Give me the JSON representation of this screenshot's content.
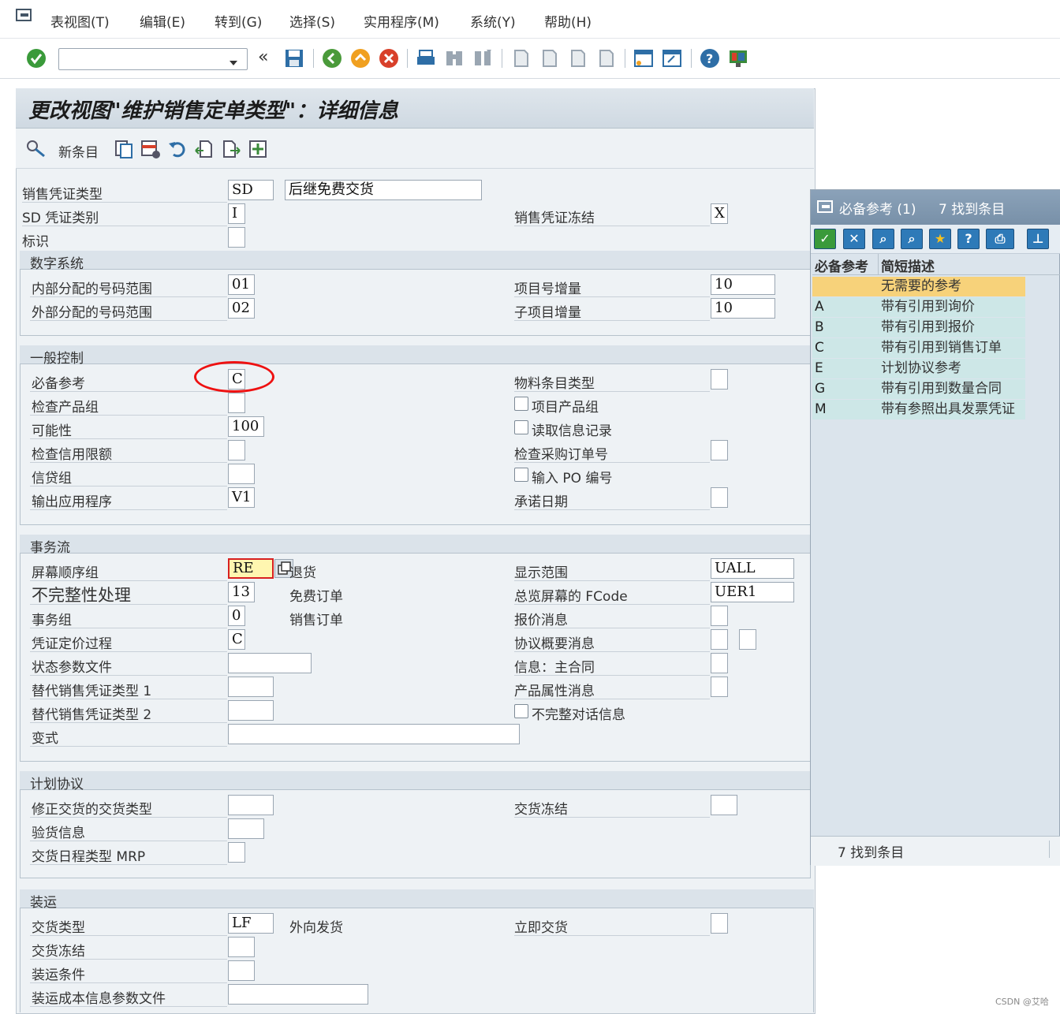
{
  "menu": [
    "表视图(T)",
    "编辑(E)",
    "转到(G)",
    "选择(S)",
    "实用程序(M)",
    "系统(Y)",
    "帮助(H)"
  ],
  "toolbar": {
    "command_field_value": "",
    "back_glyph": "«"
  },
  "title": "更改视图\"维护销售定单类型\"：详细信息",
  "app_toolbar": {
    "new_entries": "新条目"
  },
  "header": {
    "sales_doc_type_label": "销售凭证类型",
    "sales_doc_type_value": "SD",
    "sales_doc_type_desc": "后继免费交货",
    "sd_category_label": "SD 凭证类别",
    "sd_category_value": "I",
    "sales_doc_block_label": "销售凭证冻结",
    "sales_doc_block_value": "X",
    "indicator_label": "标识",
    "indicator_value": ""
  },
  "number_system": {
    "title": "数字系统",
    "internal_label": "内部分配的号码范围",
    "internal_value": "01",
    "external_label": "外部分配的号码范围",
    "external_value": "02",
    "item_inc_label": "项目号增量",
    "item_inc_value": "10",
    "subitem_inc_label": "子项目增量",
    "subitem_inc_value": "10"
  },
  "general_control": {
    "title": "一般控制",
    "ref_mandatory_label": "必备参考",
    "ref_mandatory_value": "C",
    "check_div_label": "检查产品组",
    "check_div_value": "",
    "probability_label": "可能性",
    "probability_value": "100",
    "check_credit_label": "检查信用限额",
    "check_credit_value": "",
    "credit_group_label": "信贷组",
    "credit_group_value": "",
    "output_app_label": "输出应用程序",
    "output_app_value": "V1",
    "item_cat_label": "物料条目类型",
    "item_cat_value": "",
    "item_div_label": "项目产品组",
    "read_info_label": "读取信息记录",
    "check_po_label": "检查采购订单号",
    "check_po_value": "",
    "enter_po_label": "输入 PO 编号",
    "commit_date_label": "承诺日期",
    "commit_date_value": ""
  },
  "transaction_flow": {
    "title": "事务流",
    "screen_seq_label": "屏幕顺序组",
    "screen_seq_value": "RE",
    "screen_seq_desc": "退货",
    "incomp_label": "不完整性处理",
    "incomp_value": "13",
    "incomp_desc": "免费订单",
    "trans_group_label": "事务组",
    "trans_group_value": "0",
    "trans_group_desc": "销售订单",
    "pricing_label": "凭证定价过程",
    "pricing_value": "C",
    "status_profile_label": "状态参数文件",
    "status_profile_value": "",
    "alt1_label": "替代销售凭证类型 1",
    "alt1_value": "",
    "alt2_label": "替代销售凭证类型 2",
    "alt2_value": "",
    "variant_label": "变式",
    "variant_value": "",
    "display_range_label": "显示范围",
    "display_range_value": "UALL",
    "fcode_label": "总览屏幕的 FCode",
    "fcode_value": "UER1",
    "quot_msg_label": "报价消息",
    "quot_msg_value": "",
    "agreement_msg_label": "协议概要消息",
    "agreement_msg_value": "",
    "agreement_msg_value2": "",
    "master_contract_label": "信息：主合同",
    "master_contract_value": "",
    "product_attr_label": "产品属性消息",
    "product_attr_value": "",
    "incomp_dialog_label": "不完整对话信息"
  },
  "scheduling_agreement": {
    "title": "计划协议",
    "corr_del_label": "修正交货的交货类型",
    "corr_del_value": "",
    "gr_info_label": "验货信息",
    "gr_info_value": "",
    "mrp_label": "交货日程类型 MRP",
    "mrp_value": "",
    "del_block_label": "交货冻结",
    "del_block_value": ""
  },
  "shipping": {
    "title": "装运",
    "del_type_label": "交货类型",
    "del_type_value": "LF",
    "del_type_desc": "外向发货",
    "ship_block_label": "交货冻结",
    "ship_block_value": "",
    "ship_cond_label": "装运条件",
    "ship_cond_value": "",
    "ship_cost_label": "装运成本信息参数文件",
    "ship_cost_value": "",
    "immediate_label": "立即交货",
    "immediate_value": ""
  },
  "popup": {
    "title": "必备参考 (1)",
    "count_text": "7 找到条目",
    "col_key": "必备参考",
    "col_desc": "简短描述",
    "rows": [
      {
        "key": "",
        "desc": "无需要的参考"
      },
      {
        "key": "A",
        "desc": "带有引用到询价"
      },
      {
        "key": "B",
        "desc": "带有引用到报价"
      },
      {
        "key": "C",
        "desc": "带有引用到销售订单"
      },
      {
        "key": "E",
        "desc": "计划协议参考"
      },
      {
        "key": "G",
        "desc": "带有引用到数量合同"
      },
      {
        "key": "M",
        "desc": "带有参照出具发票凭证"
      }
    ],
    "status_text": "7 找到条目"
  },
  "watermark": "CSDN @艾哈",
  "colors": {
    "highlight_row": "#f7d27a",
    "list_row": "#cde7e7",
    "annotation_circle": "#e11"
  }
}
